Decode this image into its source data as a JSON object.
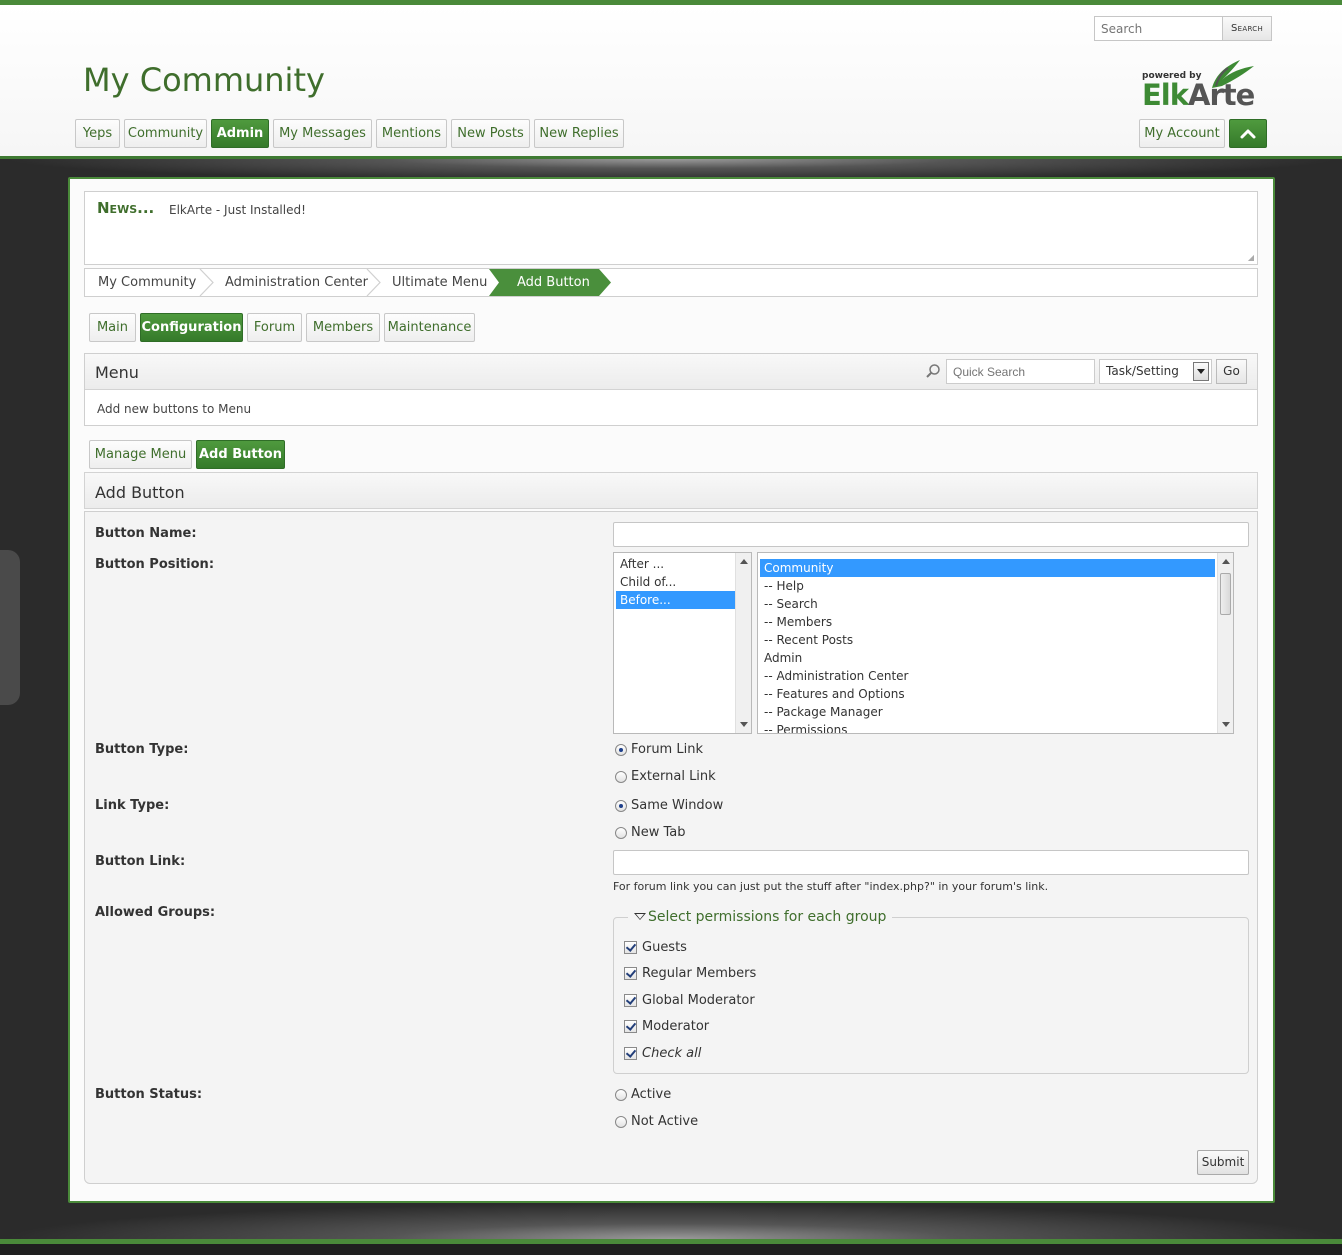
{
  "colors": {
    "brand_green": "#4a8a3a",
    "selection_blue": "#3399ff",
    "page_bg": "#2b2b2b"
  },
  "header": {
    "forum_title": "My Community",
    "search": {
      "placeholder": "Search",
      "button": "Search"
    },
    "logo": {
      "powered_by": "powered by",
      "brand_elk": "Elk",
      "brand_arte": "Arte"
    },
    "menu": [
      {
        "label": "Yeps"
      },
      {
        "label": "Community"
      },
      {
        "label": "Admin",
        "active": true
      },
      {
        "label": "My Messages"
      },
      {
        "label": "Mentions"
      },
      {
        "label": "New Posts"
      },
      {
        "label": "New Replies"
      }
    ],
    "account_button": "My Account",
    "collapse_icon": "chevron-up-icon"
  },
  "news": {
    "label": "News...",
    "text": "ElkArte - Just Installed!"
  },
  "breadcrumb": [
    "My Community",
    "Administration Center",
    "Ultimate Menu",
    "Add Button"
  ],
  "admin_tabs": [
    {
      "label": "Main"
    },
    {
      "label": "Configuration",
      "active": true
    },
    {
      "label": "Forum"
    },
    {
      "label": "Members"
    },
    {
      "label": "Maintenance"
    }
  ],
  "menu_section": {
    "title": "Menu",
    "description": "Add new buttons to Menu",
    "quick_search_placeholder": "Quick Search",
    "quick_search_select": "Task/Setting",
    "go_button": "Go"
  },
  "sub_tabs": [
    {
      "label": "Manage Menu"
    },
    {
      "label": "Add Button",
      "active": true
    }
  ],
  "form": {
    "title": "Add Button",
    "labels": {
      "name": "Button Name:",
      "position": "Button Position:",
      "type": "Button Type:",
      "link_type": "Link Type:",
      "link": "Button Link:",
      "groups": "Allowed Groups:",
      "status": "Button Status:"
    },
    "name_value": "",
    "position_options": [
      "After ...",
      "Child of...",
      "Before..."
    ],
    "position_selected": "Before...",
    "parent_options": [
      "Community",
      "-- Help",
      "-- Search",
      "-- Members",
      "-- Recent Posts",
      "Admin",
      "-- Administration Center",
      "-- Features and Options",
      "-- Package Manager",
      "-- Permissions"
    ],
    "parent_selected": "Community",
    "button_type": {
      "options": [
        "Forum Link",
        "External Link"
      ],
      "selected": "Forum Link"
    },
    "link_type": {
      "options": [
        "Same Window",
        "New Tab"
      ],
      "selected": "Same Window"
    },
    "link_value": "",
    "link_hint": "For forum link you can just put the stuff after \"index.php?\" in your forum's link.",
    "groups_legend": "Select permissions for each group",
    "groups": [
      {
        "label": "Guests",
        "checked": true
      },
      {
        "label": "Regular Members",
        "checked": true
      },
      {
        "label": "Global Moderator",
        "checked": true
      },
      {
        "label": "Moderator",
        "checked": true
      },
      {
        "label": "Check all",
        "checked": true
      }
    ],
    "status": {
      "options": [
        "Active",
        "Not Active"
      ],
      "selected": ""
    },
    "submit": "Submit"
  }
}
